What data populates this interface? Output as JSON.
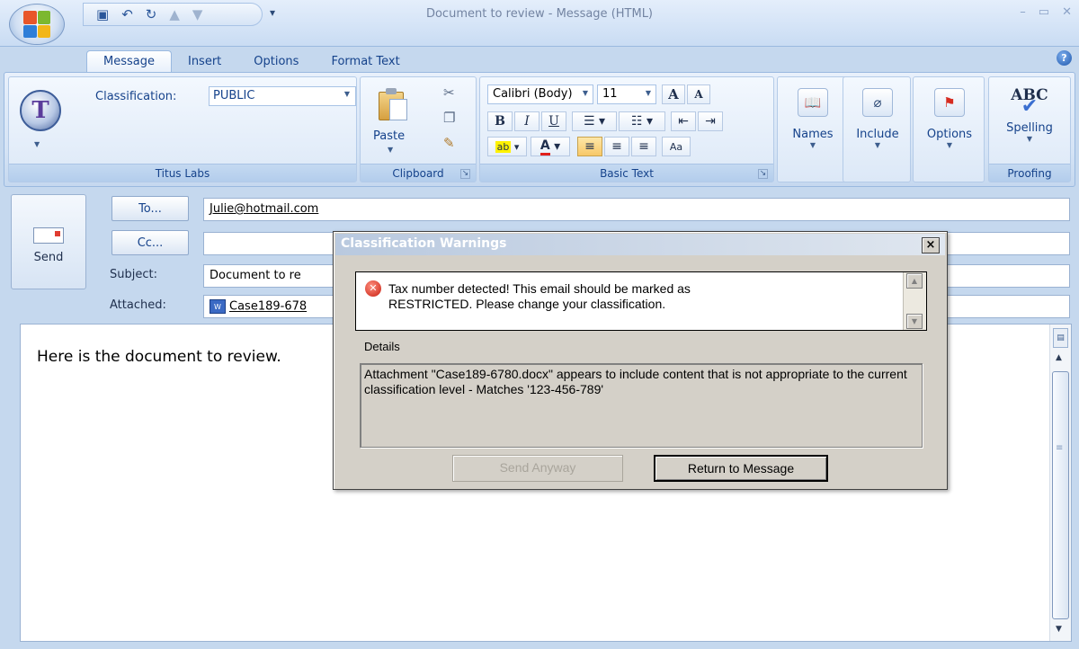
{
  "window": {
    "title": "Document to review - Message (HTML)",
    "controls": [
      "–",
      "▭",
      "✕"
    ]
  },
  "quick_access": {
    "icons": [
      "save-icon",
      "undo-icon",
      "redo-icon",
      "previous-item-icon",
      "next-item-icon"
    ],
    "more_glyph": "▾"
  },
  "tabs": [
    "Message",
    "Insert",
    "Options",
    "Format Text"
  ],
  "active_tab": "Message",
  "ribbon": {
    "titus": {
      "classification_label": "Classification:",
      "classification_value": "PUBLIC",
      "group_label": "Titus Labs"
    },
    "clipboard": {
      "paste_label": "Paste",
      "group_label": "Clipboard"
    },
    "basic_text": {
      "font_name": "Calibri (Body)",
      "font_size": "11",
      "bold": "B",
      "italic": "I",
      "underline": "U",
      "grow_font": "A",
      "shrink_font": "A",
      "group_label": "Basic Text"
    },
    "names": {
      "label": "Names"
    },
    "include": {
      "label": "Include"
    },
    "options": {
      "label": "Options"
    },
    "proofing": {
      "spelling_label": "Spelling",
      "abc": "ABC",
      "group_label": "Proofing"
    }
  },
  "header": {
    "send_label": "Send",
    "to_button": "To...",
    "cc_button": "Cc...",
    "to_value": "Julie@hotmail.com",
    "cc_value": "",
    "subject_label": "Subject:",
    "subject_value": "Document to re",
    "attached_label": "Attached:",
    "attached_value": "Case189-678"
  },
  "body": {
    "text": "Here is the document to review."
  },
  "dialog": {
    "title": "Classification Warnings",
    "close": "×",
    "warning_line1": "Tax number detected! This email should be marked as",
    "warning_line2": "RESTRICTED. Please change your classification.",
    "details_label": "Details",
    "details_text": "Attachment \"Case189-6780.docx\" appears to include content that is not appropriate to the current classification level - Matches '123-456-789'",
    "send_anyway": "Send Anyway",
    "return_to_message": "Return to Message"
  },
  "colors": {
    "ribbon_text": "#15428b",
    "office_blue": "#c5d8ee",
    "dialog_face": "#d4d0c8",
    "error_red": "#c81e10"
  }
}
